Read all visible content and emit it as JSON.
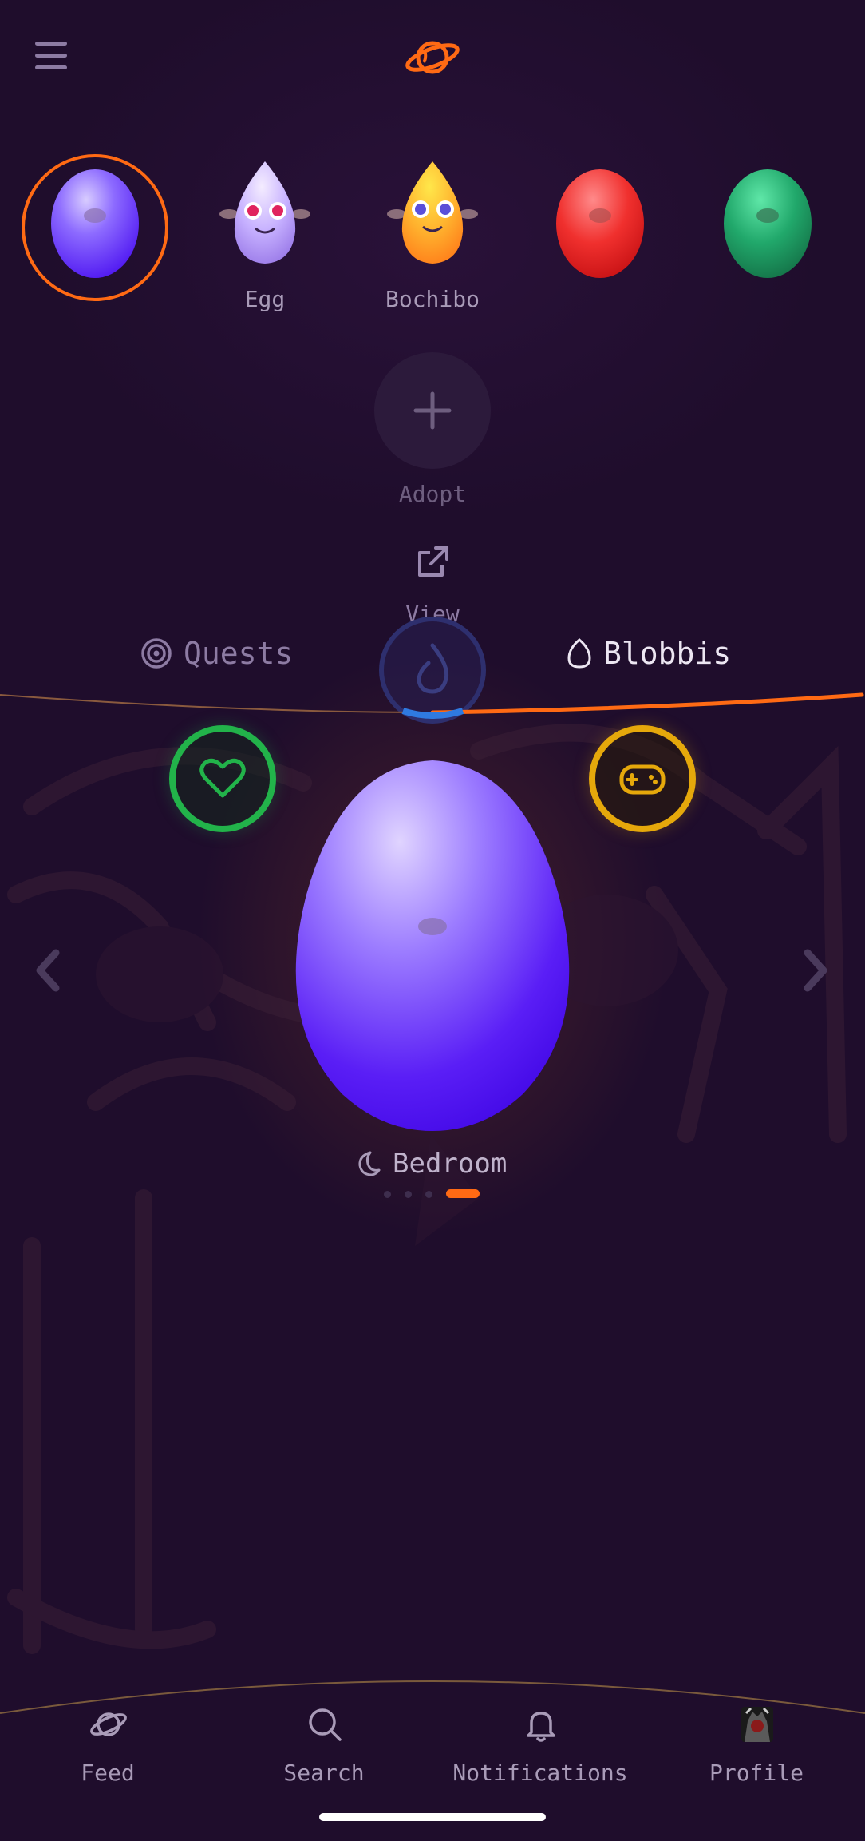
{
  "header": {
    "menu_icon": "hamburger-menu-icon",
    "logo_icon": "planet-logo-icon"
  },
  "pets": [
    {
      "label": "",
      "color": "#6a3cff",
      "selected": true
    },
    {
      "label": "Egg",
      "color": "#c4a8ff"
    },
    {
      "label": "Bochibo",
      "color": "#ffb22e"
    },
    {
      "label": "",
      "color": "#e8262b"
    },
    {
      "label": "",
      "color": "#22a86a"
    }
  ],
  "adopt": {
    "label": "Adopt",
    "icon": "plus-icon"
  },
  "view": {
    "label": "View",
    "icon": "external-link-icon"
  },
  "tabs": {
    "quests": {
      "label": "Quests",
      "icon": "target-icon"
    },
    "blobbis": {
      "label": "Blobbis",
      "icon": "egg-outline-icon",
      "active": true
    }
  },
  "stats": {
    "health_icon": "heart-icon",
    "play_icon": "gamepad-icon",
    "health_color": "#22b34a",
    "play_color": "#e5a80b"
  },
  "room": {
    "label": "Bedroom",
    "icon": "moon-icon",
    "page_count": 4,
    "active_index": 3
  },
  "nav": [
    {
      "label": "Feed",
      "icon": "planet-icon"
    },
    {
      "label": "Search",
      "icon": "search-icon"
    },
    {
      "label": "Notifications",
      "icon": "bell-icon"
    },
    {
      "label": "Profile",
      "icon": "avatar"
    }
  ],
  "colors": {
    "accent": "#ff6a14",
    "background": "#1f0d2c",
    "text_muted": "#a99bb8"
  }
}
